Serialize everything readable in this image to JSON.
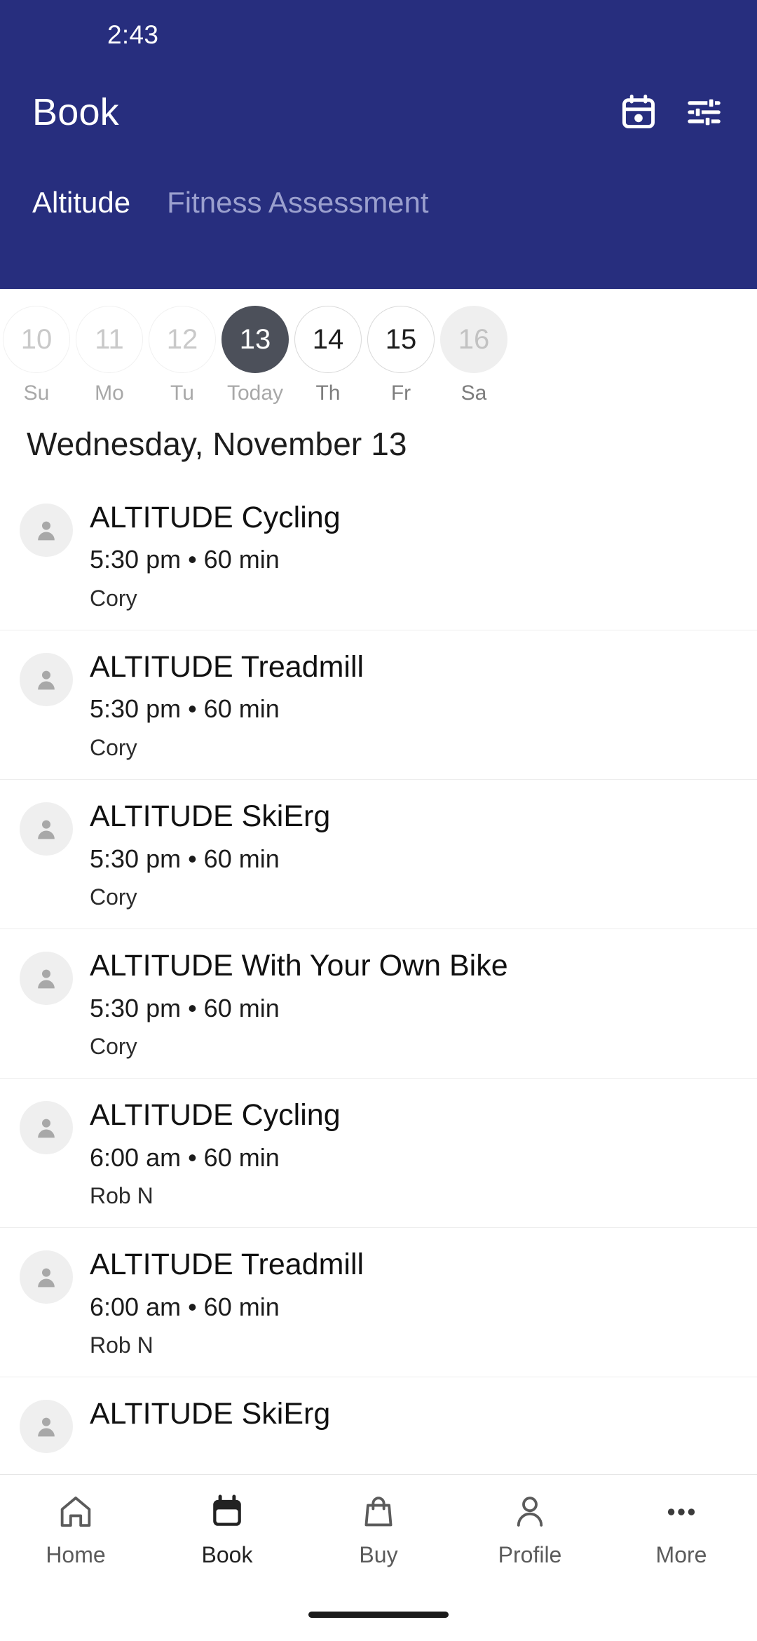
{
  "theme": {
    "header_bg": "#272e7e",
    "header_text": "#ffffff",
    "tab_inactive": "#9ba0ce",
    "today_circle": "#4c505a",
    "page_bg": "#ffffff"
  },
  "status_bar": {
    "time": "2:43"
  },
  "app_bar": {
    "title": "Book",
    "calendar_icon": "calendar-icon",
    "filter_icon": "filter-sliders-icon"
  },
  "tabs": [
    {
      "label": "Altitude",
      "active": true
    },
    {
      "label": "Fitness Assessment",
      "active": false
    }
  ],
  "date_strip": [
    {
      "day": "10",
      "weekday": "Su",
      "state": "past"
    },
    {
      "day": "11",
      "weekday": "Mo",
      "state": "past"
    },
    {
      "day": "12",
      "weekday": "Tu",
      "state": "past"
    },
    {
      "day": "13",
      "weekday": "Today",
      "state": "today"
    },
    {
      "day": "14",
      "weekday": "Th",
      "state": "future"
    },
    {
      "day": "15",
      "weekday": "Fr",
      "state": "future"
    },
    {
      "day": "16",
      "weekday": "Sa",
      "state": "disabled"
    }
  ],
  "selected_date_heading": "Wednesday, November 13",
  "classes": [
    {
      "title": "ALTITUDE Cycling",
      "meta": "5:30 pm • 60 min",
      "instructor": "Cory"
    },
    {
      "title": "ALTITUDE Treadmill",
      "meta": "5:30 pm • 60 min",
      "instructor": "Cory"
    },
    {
      "title": "ALTITUDE SkiErg",
      "meta": "5:30 pm • 60 min",
      "instructor": "Cory"
    },
    {
      "title": "ALTITUDE With Your Own Bike",
      "meta": "5:30 pm • 60 min",
      "instructor": "Cory"
    },
    {
      "title": "ALTITUDE Cycling",
      "meta": "6:00 am • 60 min",
      "instructor": "Rob N"
    },
    {
      "title": "ALTITUDE Treadmill",
      "meta": "6:00 am • 60 min",
      "instructor": "Rob N"
    },
    {
      "title": "ALTITUDE SkiErg",
      "meta": "",
      "instructor": ""
    }
  ],
  "bottom_nav": [
    {
      "label": "Home",
      "icon": "home-icon",
      "active": false
    },
    {
      "label": "Book",
      "icon": "calendar-icon",
      "active": true
    },
    {
      "label": "Buy",
      "icon": "shopping-bag-icon",
      "active": false
    },
    {
      "label": "Profile",
      "icon": "person-icon",
      "active": false
    },
    {
      "label": "More",
      "icon": "ellipsis-icon",
      "active": false
    }
  ]
}
